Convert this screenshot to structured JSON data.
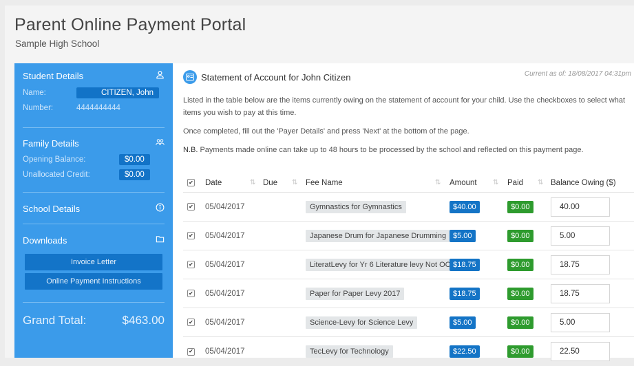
{
  "header": {
    "title": "Parent Online Payment Portal",
    "school": "Sample High School"
  },
  "sidebar": {
    "student": {
      "heading": "Student Details",
      "name_label": "Name:",
      "name_value": "CITIZEN, John",
      "number_label": "Number:",
      "number_value": "4444444444"
    },
    "family": {
      "heading": "Family Details",
      "opening_label": "Opening Balance:",
      "opening_value": "$0.00",
      "unallocated_label": "Unallocated Credit:",
      "unallocated_value": "$0.00"
    },
    "school": {
      "heading": "School Details"
    },
    "downloads": {
      "heading": "Downloads",
      "invoice_label": "Invoice Letter",
      "instructions_label": "Online Payment Instructions"
    },
    "grand_total": {
      "label": "Grand Total:",
      "value": "$463.00"
    }
  },
  "main": {
    "statement_title": "Statement of Account for John Citizen",
    "current_as": "Current as of: 18/08/2017 04:31pm",
    "intro": "Listed in the table below are the items currently owing on the statement of account for your child. Use the checkboxes to select what items you wish to pay at this time.",
    "instruction": "Once completed, fill out the 'Payer Details' and press 'Next' at the bottom of the page.",
    "nb_label": "N.B.",
    "nb_text": "Payments made online can take up to 48 hours to be processed by the school and reflected on this payment page."
  },
  "table": {
    "headers": {
      "date": "Date",
      "due": "Due",
      "fee": "Fee Name",
      "amount": "Amount",
      "paid": "Paid",
      "balance": "Balance Owing ($)"
    },
    "rows": [
      {
        "date": "05/04/2017",
        "fee": "Gymnastics for Gymnastics",
        "amount": "$40.00",
        "paid": "$0.00",
        "balance": "40.00"
      },
      {
        "date": "05/04/2017",
        "fee": "Japanese Drum for Japanese Drumming",
        "amount": "$5.00",
        "paid": "$0.00",
        "balance": "5.00"
      },
      {
        "date": "05/04/2017",
        "fee": "LiteratLevy for Yr 6 Literature levy Not OC",
        "amount": "$18.75",
        "paid": "$0.00",
        "balance": "18.75"
      },
      {
        "date": "05/04/2017",
        "fee": "Paper for Paper Levy 2017",
        "amount": "$18.75",
        "paid": "$0.00",
        "balance": "18.75"
      },
      {
        "date": "05/04/2017",
        "fee": "Science-Levy for Science Levy",
        "amount": "$5.00",
        "paid": "$0.00",
        "balance": "5.00"
      },
      {
        "date": "05/04/2017",
        "fee": "TecLevy for Technology",
        "amount": "$22.50",
        "paid": "$0.00",
        "balance": "22.50"
      }
    ]
  },
  "colors": {
    "sidebar": "#3b9bea",
    "pill": "#1273c7",
    "amount": "#1474c6",
    "paid": "#2e9b2e"
  },
  "icons": {
    "student": "user-icon",
    "family": "users-icon",
    "school": "info-icon",
    "downloads": "folder-icon",
    "statement": "id-card-icon"
  }
}
